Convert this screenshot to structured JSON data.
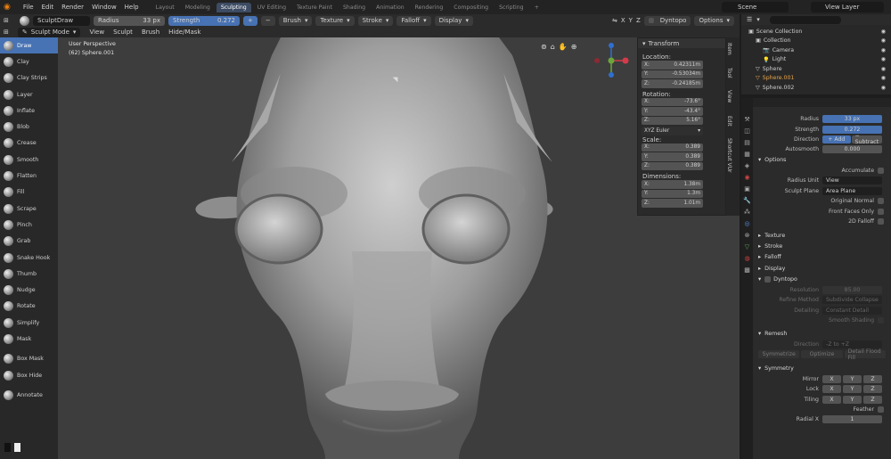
{
  "menu": [
    "File",
    "Edit",
    "Render",
    "Window",
    "Help"
  ],
  "workspace_tabs": [
    "Layout",
    "Modeling",
    "Sculpting",
    "UV Editing",
    "Texture Paint",
    "Shading",
    "Animation",
    "Rendering",
    "Compositing",
    "Scripting"
  ],
  "active_tab": "Sculpting",
  "scene": "Scene",
  "view_layer": "View Layer",
  "tool_header": {
    "brush_name": "SculptDraw",
    "radius_label": "Radius",
    "radius_value": "33 px",
    "strength_label": "Strength",
    "strength_value": "0.272",
    "plus": "+",
    "minus": "−",
    "menus": [
      "Brush",
      "Texture",
      "Stroke",
      "Falloff",
      "Display"
    ],
    "symmetry": [
      "X",
      "Y",
      "Z"
    ],
    "dyntopo": "Dyntopo",
    "options": "Options"
  },
  "viewport_header": {
    "mode": "Sculpt Mode",
    "menus": [
      "View",
      "Sculpt",
      "Brush",
      "Hide/Mask"
    ]
  },
  "viewport_info": {
    "line1": "User Perspective",
    "line2": "(62) Sphere.001"
  },
  "tools": [
    "Draw",
    "Clay",
    "Clay Strips",
    "Layer",
    "Inflate",
    "Blob",
    "Crease",
    "Smooth",
    "Flatten",
    "Fill",
    "Scrape",
    "Pinch",
    "Grab",
    "Snake Hook",
    "Thumb",
    "Nudge",
    "Rotate",
    "Simplify",
    "Mask",
    "Box Mask",
    "Box Hide",
    "Annotate"
  ],
  "active_tool": "Draw",
  "transform": {
    "title": "Transform",
    "location_label": "Location:",
    "location": [
      {
        "axis": "X:",
        "value": "0.42311m"
      },
      {
        "axis": "Y:",
        "value": "-0.53034m"
      },
      {
        "axis": "Z:",
        "value": "-0.24185m"
      }
    ],
    "rotation_label": "Rotation:",
    "rotation": [
      {
        "axis": "X:",
        "value": "-73.6°"
      },
      {
        "axis": "Y:",
        "value": "-43.4°"
      },
      {
        "axis": "Z:",
        "value": "5.16°"
      }
    ],
    "rotation_mode": "XYZ Euler",
    "scale_label": "Scale:",
    "scale": [
      {
        "axis": "X:",
        "value": "0.389"
      },
      {
        "axis": "Y:",
        "value": "0.389"
      },
      {
        "axis": "Z:",
        "value": "0.389"
      }
    ],
    "dimensions_label": "Dimensions:",
    "dimensions": [
      {
        "axis": "X:",
        "value": "1.38m"
      },
      {
        "axis": "Y:",
        "value": "1.3m"
      },
      {
        "axis": "Z:",
        "value": "1.01m"
      }
    ]
  },
  "sidebar_tabs": [
    "Item",
    "Tool",
    "View",
    "Edit",
    "Shortcut VUr"
  ],
  "outliner": {
    "items": [
      {
        "label": "Scene Collection"
      },
      {
        "label": "Collection"
      },
      {
        "label": "Camera"
      },
      {
        "label": "Light"
      },
      {
        "label": "Sphere"
      },
      {
        "label": "Sphere.001"
      },
      {
        "label": "Sphere.002"
      }
    ]
  },
  "properties": {
    "radius_label": "Radius",
    "radius_value": "33 px",
    "strength_label": "Strength",
    "strength_value": "0.272",
    "direction_label": "Direction",
    "add_label": "+ Add",
    "subtract_label": "− Subtract",
    "autosmooth_label": "Autosmooth",
    "autosmooth_value": "0.000",
    "options_header": "Options",
    "accumulate_label": "Accumulate",
    "radius_unit_label": "Radius Unit",
    "radius_unit_value": "View",
    "sculpt_plane_label": "Sculpt Plane",
    "sculpt_plane_value": "Area Plane",
    "original_normal_label": "Original Normal",
    "front_faces_label": "Front Faces Only",
    "falloff_2d_label": "2D Falloff",
    "panels": [
      "Texture",
      "Stroke",
      "Falloff",
      "Display"
    ],
    "dyntopo_label": "Dyntopo",
    "resolution_label": "Resolution",
    "resolution_value": "85.00",
    "refine_label": "Refine Method",
    "refine_value": "Subdivide Collapse",
    "detailing_label": "Detailing",
    "detailing_value": "Constant Detail",
    "smooth_shading_label": "Smooth Shading",
    "remesh_label": "Remesh",
    "dir_label": "Direction",
    "dir_value": "-Z to +Z",
    "symmetrize_label": "Symmetrize",
    "optimize_label": "Optimize",
    "detail_flood_label": "Detail Flood Fill",
    "symmetry_label": "Symmetry",
    "mirror_label": "Mirror",
    "lock_label": "Lock",
    "tiling_label": "Tiling",
    "feather_label": "Feather",
    "radial_label": "Radial X",
    "radial_value": "1",
    "axes": [
      "X",
      "Y",
      "Z"
    ]
  },
  "colors": {
    "accent": "#4772b3",
    "active_object": "#e8a54b",
    "topbar": "#232323",
    "panel": "#2b2b2b"
  }
}
